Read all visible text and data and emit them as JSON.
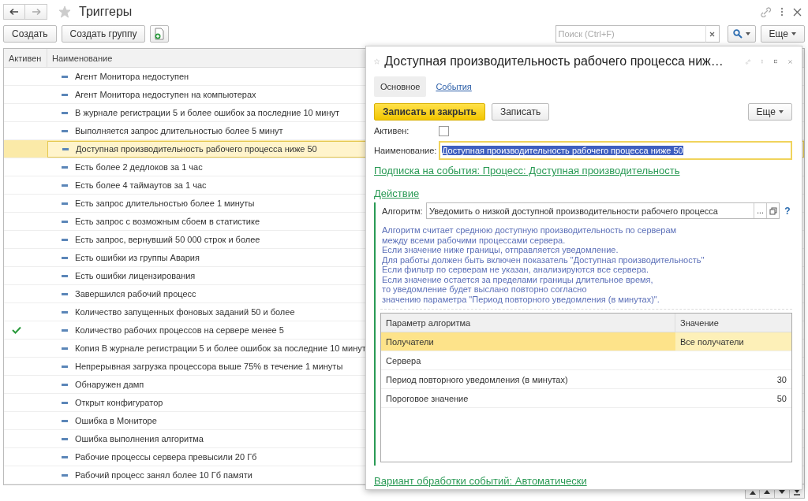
{
  "window": {
    "title": "Триггеры"
  },
  "toolbar": {
    "buttons": [
      "Создать",
      "Создать группу"
    ],
    "search": {
      "placeholder": "Поиск (Ctrl+F)"
    },
    "more": "Еще"
  },
  "list": {
    "columns": [
      "Активен",
      "Наименование"
    ],
    "rows": [
      {
        "name": "Агент Монитора недоступен",
        "active": false,
        "selected": false
      },
      {
        "name": "Агент Монитора недоступен на компьютерах",
        "active": false,
        "selected": false
      },
      {
        "name": "В журнале регистрации 5 и более ошибок за последние 10 минут",
        "active": false,
        "selected": false
      },
      {
        "name": "Выполняется запрос длительностью более 5 минут",
        "active": false,
        "selected": false
      },
      {
        "name": "Доступная производительность рабочего процесса ниже 50",
        "active": false,
        "selected": true
      },
      {
        "name": "Есть более 2 дедлоков за 1 час",
        "active": false,
        "selected": false
      },
      {
        "name": "Есть более 4 таймаутов за 1 час",
        "active": false,
        "selected": false
      },
      {
        "name": "Есть запрос длительностью более 1 минуты",
        "active": false,
        "selected": false
      },
      {
        "name": "Есть запрос с возможным сбоем в статистике",
        "active": false,
        "selected": false
      },
      {
        "name": "Есть запрос, вернувший 50 000 строк и более",
        "active": false,
        "selected": false
      },
      {
        "name": "Есть ошибки из группы Авария",
        "active": false,
        "selected": false
      },
      {
        "name": "Есть ошибки лицензирования",
        "active": false,
        "selected": false
      },
      {
        "name": "Завершился рабочий процесс",
        "active": false,
        "selected": false
      },
      {
        "name": "Количество запущенных фоновых заданий 50 и более",
        "active": false,
        "selected": false
      },
      {
        "name": "Количество рабочих процессов на сервере менее 5",
        "active": true,
        "selected": false
      },
      {
        "name": "Копия В журнале регистрации 5 и более ошибок за последние 10 минут",
        "active": false,
        "selected": false
      },
      {
        "name": "Непрерывная загрузка процессора выше 75% в течение 1 минуты",
        "active": false,
        "selected": false
      },
      {
        "name": "Обнаружен дамп",
        "active": false,
        "selected": false
      },
      {
        "name": "Открыт конфигуратор",
        "active": false,
        "selected": false
      },
      {
        "name": "Ошибка в Мониторе",
        "active": false,
        "selected": false
      },
      {
        "name": "Ошибка выполнения алгоритма",
        "active": false,
        "selected": false
      },
      {
        "name": "Рабочие процессы сервера превысили 20 Гб",
        "active": false,
        "selected": false
      },
      {
        "name": "Рабочий процесс занял более 10 Гб памяти",
        "active": false,
        "selected": false
      }
    ]
  },
  "dialog": {
    "title": "Доступная производительность рабочего процесса ниж…",
    "tabs": [
      {
        "label": "Основное",
        "selected": true
      },
      {
        "label": "События",
        "selected": false
      }
    ],
    "buttons": {
      "primary": "Записать и закрыть",
      "save": "Записать",
      "more": "Еще"
    },
    "active": {
      "label": "Активен:",
      "checked": false
    },
    "name": {
      "label": "Наименование:",
      "value": "Доступная производительность рабочего процесса ниже 50"
    },
    "subscription_link": "Подписка на события: Процесс: Доступная производительность",
    "action": {
      "heading": "Действие",
      "algorithm": {
        "label": "Алгоритм:",
        "value": "Уведомить о низкой доступной производительности рабочего процесса",
        "choose": "...",
        "help": "?"
      },
      "description": "Алгоритм считает среднюю доступную производительность по серверам\nмежду всеми рабочими процессами сервера.\nЕсли значение ниже границы, отправляется уведомление.\nДля работы должен быть включен показатель \"Доступная производительность\"\nЕсли фильтр по серверам не указан, анализируются все сервера.\nЕсли значение остается за пределами границы длительное время,\nто уведомление будет выслано повторно согласно\nзначению параметра \"Период повторного уведомления (в минутах)\".",
      "params": {
        "columns": [
          "Параметр алгоритма",
          "Значение"
        ],
        "rows": [
          {
            "param": "Получатели",
            "value": "Все получатели",
            "selected": true
          },
          {
            "param": "Сервера",
            "selected": false
          },
          {
            "param": "Период повторного уведомления (в минутах)",
            "value": "30",
            "selected": false
          },
          {
            "param": "Пороговое значение",
            "value": "50",
            "selected": false
          }
        ]
      }
    },
    "processing_link": "Вариант обработки событий: Автоматически"
  }
}
